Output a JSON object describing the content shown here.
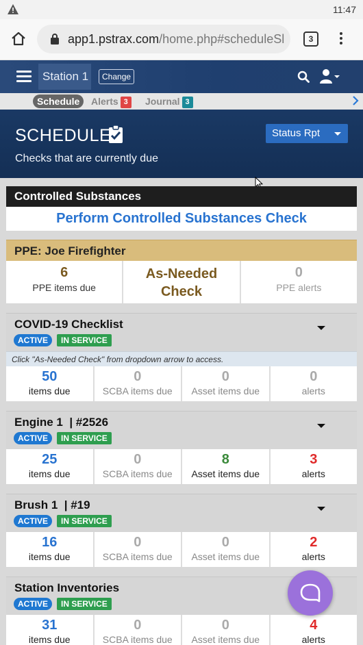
{
  "status_bar": {
    "time": "11:47",
    "warning_icon": "warning-icon"
  },
  "browser": {
    "url_domain": "app1.pstrax.com",
    "url_path": "/home.php#scheduleSl",
    "tab_count": "3"
  },
  "nav": {
    "station": "Station 1",
    "change_label": "Change"
  },
  "tabs": [
    {
      "label": "Schedule"
    },
    {
      "label": "Alerts",
      "count": "3"
    },
    {
      "label": "Journal",
      "count": "3"
    }
  ],
  "hero": {
    "title": "SCHEDULE",
    "subtitle": "Checks that are currently due",
    "status_button": "Status Rpt"
  },
  "controlled": {
    "title": "Controlled Substances",
    "action": "Perform Controlled Substances Check"
  },
  "ppe": {
    "title": "PPE: Joe Firefighter",
    "items_due_value": "6",
    "items_due_label": "PPE items due",
    "as_needed_line1": "As-Needed",
    "as_needed_line2": "Check",
    "alerts_value": "0",
    "alerts_label": "PPE alerts"
  },
  "badges": {
    "active": "ACTIVE",
    "in_service": "IN SERVICE"
  },
  "covid": {
    "title": "COVID-19 Checklist",
    "note": "Click \"As-Needed Check\" from dropdown arrow to access.",
    "stats": [
      {
        "value": "50",
        "label": "items due"
      },
      {
        "value": "0",
        "label": "SCBA items due"
      },
      {
        "value": "0",
        "label": "Asset items due"
      },
      {
        "value": "0",
        "label": "alerts"
      }
    ]
  },
  "engine": {
    "title": "Engine 1",
    "number": "| #2526",
    "stats": [
      {
        "value": "25",
        "label": "items due"
      },
      {
        "value": "0",
        "label": "SCBA items due"
      },
      {
        "value": "8",
        "label": "Asset items due"
      },
      {
        "value": "3",
        "label": "alerts"
      }
    ]
  },
  "brush": {
    "title": "Brush 1",
    "number": "| #19",
    "stats": [
      {
        "value": "16",
        "label": "items due"
      },
      {
        "value": "0",
        "label": "SCBA items due"
      },
      {
        "value": "0",
        "label": "Asset items due"
      },
      {
        "value": "2",
        "label": "alerts"
      }
    ]
  },
  "inventories": {
    "title": "Station Inventories",
    "stats": [
      {
        "value": "31",
        "label": "items due"
      },
      {
        "value": "0",
        "label": "SCBA items due"
      },
      {
        "value": "0",
        "label": "Asset items due"
      },
      {
        "value": "4",
        "label": "alerts"
      }
    ]
  },
  "colors": {
    "accent": "#2873d0",
    "header": "#1a3964",
    "ppe": "#d9bc7c",
    "alert": "#e02a2a",
    "fab": "#9b71db"
  }
}
